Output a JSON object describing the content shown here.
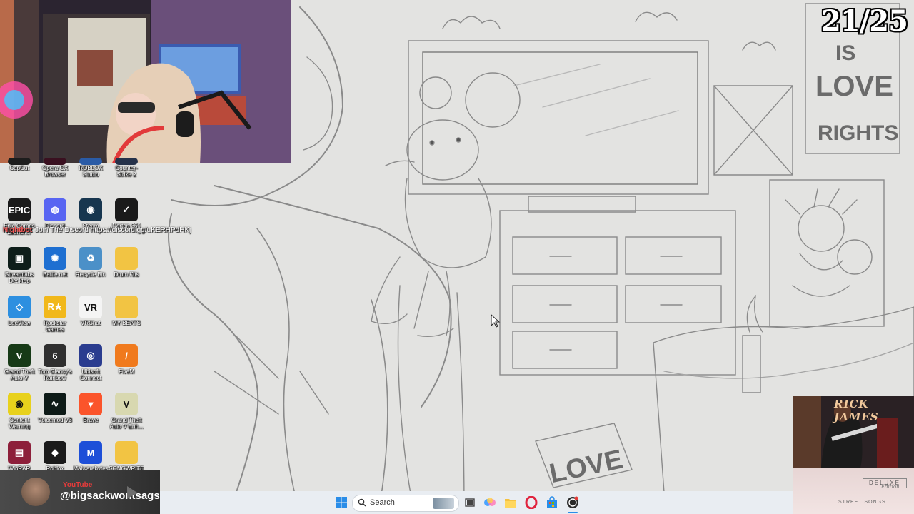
{
  "counter": "21/25",
  "desktop_icons": [
    {
      "label": "CapCut",
      "color": "#1d1d1d",
      "glyph": "",
      "cut": true
    },
    {
      "label": "Opera GX Browser",
      "color": "#3a1020",
      "glyph": "",
      "cut": true
    },
    {
      "label": "ROBLOX Studio",
      "color": "#2a5ba6",
      "glyph": "",
      "cut": true
    },
    {
      "label": "Counter-Strike 2",
      "color": "#26324a",
      "glyph": "",
      "cut": true
    },
    {
      "label": "Epic Games Launcher",
      "color": "#1b1b1b",
      "glyph": "EPIC"
    },
    {
      "label": "Discord",
      "color": "#5865f2",
      "glyph": "◍"
    },
    {
      "label": "Steam",
      "color": "#17364f",
      "glyph": "◉"
    },
    {
      "label": "Norton 360",
      "color": "#1a1a1a",
      "glyph": "✓"
    },
    {
      "label": "Streamlabs Desktop",
      "color": "#0e1e1a",
      "glyph": "▣"
    },
    {
      "label": "Battle.net",
      "color": "#1e6fd1",
      "glyph": "✺"
    },
    {
      "label": "Recycle Bin",
      "color": "#4b90c8",
      "glyph": "♻"
    },
    {
      "label": "Drum Kits",
      "color": "#f2c443",
      "glyph": ""
    },
    {
      "label": "LeeView",
      "color": "#2d8fe0",
      "glyph": "◇"
    },
    {
      "label": "Rockstar Games Launcher",
      "color": "#f1b81b",
      "glyph": "R★"
    },
    {
      "label": "VRChat",
      "color": "#f4f4f4",
      "glyph": "VR"
    },
    {
      "label": "MY BEATS",
      "color": "#f2c443",
      "glyph": ""
    },
    {
      "label": "Grand Theft Auto V",
      "color": "#173a17",
      "glyph": "V"
    },
    {
      "label": "Tom Clancy's Rainbow Six...",
      "color": "#2f2f2f",
      "glyph": "6"
    },
    {
      "label": "Ubisoft Connect",
      "color": "#2a3c8f",
      "glyph": "◎"
    },
    {
      "label": "FiveM",
      "color": "#f07a1d",
      "glyph": "/"
    },
    {
      "label": "Content Warning",
      "color": "#e8d11c",
      "glyph": "◉"
    },
    {
      "label": "Voicemod V3",
      "color": "#0d1a17",
      "glyph": "∿"
    },
    {
      "label": "Brave",
      "color": "#fb542b",
      "glyph": "▼"
    },
    {
      "label": "Grand Theft Auto V Enh...",
      "color": "#d8d8b0",
      "glyph": "V"
    },
    {
      "label": "WinRAR",
      "color": "#8d1f3a",
      "glyph": "▤"
    },
    {
      "label": "Roblox",
      "color": "#1a1a1a",
      "glyph": "◆"
    },
    {
      "label": "Malwarebytes",
      "color": "#1d4fd8",
      "glyph": "M"
    },
    {
      "label": "SONGWRITE",
      "color": "#f2c443",
      "glyph": ""
    }
  ],
  "chat": {
    "name": "Nightbot",
    "message": "Join The Discord https://discord.gg/uKERHPdHKj"
  },
  "youtube": {
    "platform": "YouTube",
    "handle": "@bigsackwontsags"
  },
  "taskbar": {
    "search_placeholder": "Search"
  },
  "album": {
    "artist": "RICK JAMES",
    "edition_box": "DELUXE",
    "edition": "Edition",
    "title": "STREET SONGS"
  },
  "drawing": {
    "sign_top_1": "IS",
    "sign_top_2": "LOVE",
    "sign_top_3": "RIGHTS",
    "sign_floor": "LOVE"
  }
}
